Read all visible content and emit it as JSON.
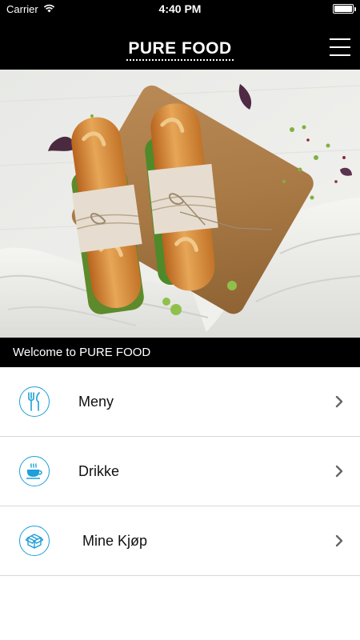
{
  "status_bar": {
    "carrier": "Carrier",
    "time": "4:40 PM",
    "battery_level": 1.0
  },
  "header": {
    "title": "PURE FOOD",
    "menu_icon": "hamburger-menu-icon"
  },
  "hero": {
    "image": "baguette-sandwiches-on-wooden-board"
  },
  "welcome": {
    "text": "Welcome to PURE FOOD"
  },
  "menu": {
    "items": [
      {
        "label": "Meny",
        "icon": "cutlery-icon"
      },
      {
        "label": "Drikke",
        "icon": "coffee-cup-icon"
      },
      {
        "label": "Mine Kjøp",
        "icon": "box-icon"
      }
    ]
  },
  "colors": {
    "accent": "#1e9fd7",
    "header_bg": "#000000",
    "divider": "#d8d8d8"
  }
}
